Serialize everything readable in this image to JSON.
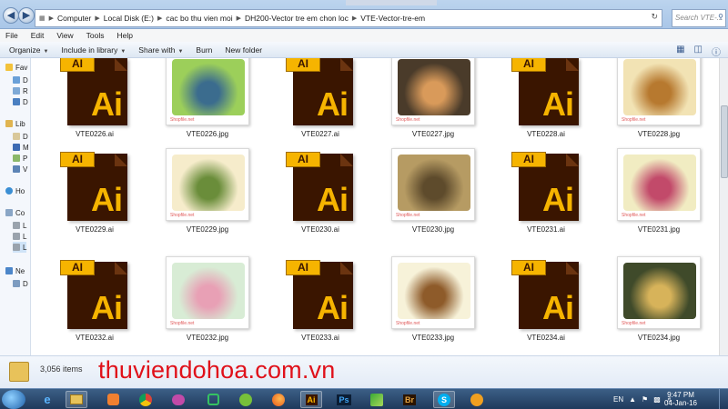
{
  "window": {
    "breadcrumbs": [
      "Computer",
      "Local Disk (E:)",
      "cac bo thu vien moi",
      "DH200-Vector tre em chon loc",
      "VTE-Vector-tre-em"
    ],
    "search_placeholder": "Search VTE-..."
  },
  "menu": [
    "File",
    "Edit",
    "View",
    "Tools",
    "Help"
  ],
  "commands": [
    "Organize",
    "Include in library",
    "Share with",
    "Burn",
    "New folder"
  ],
  "nav_pane": [
    "Fav",
    "D",
    "R",
    "D",
    "Lib",
    "D",
    "M",
    "P",
    "V",
    "Ho",
    "Co",
    "L",
    "L",
    "L",
    "Ne",
    "D"
  ],
  "files": [
    {
      "name": "VTE0226.ai",
      "type": "ai"
    },
    {
      "name": "VTE0226.jpg",
      "type": "jpg",
      "tint": "#9ccf5a",
      "tint2": "#3b6c8e"
    },
    {
      "name": "VTE0227.ai",
      "type": "ai"
    },
    {
      "name": "VTE0227.jpg",
      "type": "jpg",
      "tint": "#4a3b2a",
      "tint2": "#d99a5a"
    },
    {
      "name": "VTE0228.ai",
      "type": "ai"
    },
    {
      "name": "VTE0228.jpg",
      "type": "jpg",
      "tint": "#f2e3b4",
      "tint2": "#b7792f"
    },
    {
      "name": "VTE0229.ai",
      "type": "ai"
    },
    {
      "name": "VTE0229.jpg",
      "type": "jpg",
      "tint": "#f6eccb",
      "tint2": "#6a8d3a"
    },
    {
      "name": "VTE0230.ai",
      "type": "ai"
    },
    {
      "name": "VTE0230.jpg",
      "type": "jpg",
      "tint": "#b69b63",
      "tint2": "#5e4b2c"
    },
    {
      "name": "VTE0231.ai",
      "type": "ai"
    },
    {
      "name": "VTE0231.jpg",
      "type": "jpg",
      "tint": "#f1ecc2",
      "tint2": "#c24a6a"
    },
    {
      "name": "VTE0232.ai",
      "type": "ai"
    },
    {
      "name": "VTE0232.jpg",
      "type": "jpg",
      "tint": "#d8ecd5",
      "tint2": "#e8a0b5"
    },
    {
      "name": "VTE0233.ai",
      "type": "ai"
    },
    {
      "name": "VTE0233.jpg",
      "type": "jpg",
      "tint": "#f7f2d9",
      "tint2": "#8e5b2a"
    },
    {
      "name": "VTE0234.ai",
      "type": "ai"
    },
    {
      "name": "VTE0234.jpg",
      "type": "jpg",
      "tint": "#3f4a2a",
      "tint2": "#d7b35a"
    }
  ],
  "ai_icon": {
    "tab_text": "AI",
    "big_text": "Ai"
  },
  "watermark": "Shopfile.net",
  "details": {
    "item_count": "3,056 items",
    "site_text": "thuviendohoa.com.vn"
  },
  "taskbar": {
    "apps": [
      "ie-icon",
      "explorer-icon",
      "media-icon",
      "chrome-icon",
      "app5-icon",
      "app6-icon",
      "app7-icon",
      "firefox-icon",
      "illustrator-icon",
      "photoshop-icon",
      "app11-icon",
      "bridge-icon",
      "skype-icon",
      "app14-icon"
    ],
    "ai_label": "Ai",
    "ps_label": "Ps",
    "br_label": "Br",
    "lang": "EN",
    "time": "9:47 PM",
    "date": "04-Jan-16"
  }
}
